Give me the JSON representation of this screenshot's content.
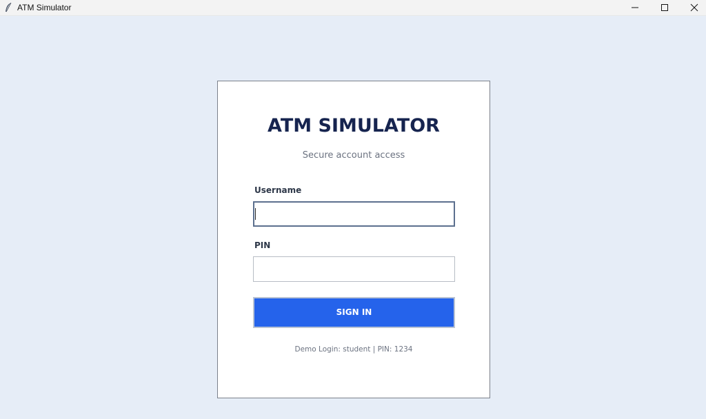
{
  "window": {
    "title": "ATM Simulator",
    "icon": "feather-icon",
    "controls": {
      "minimize": "minimize-icon",
      "maximize": "maximize-icon",
      "close": "close-icon"
    }
  },
  "login": {
    "title": "ATM SIMULATOR",
    "subtitle": "Secure account access",
    "username_label": "Username",
    "username_value": "",
    "pin_label": "PIN",
    "pin_value": "",
    "signin_label": "SIGN IN",
    "demo_text": "Demo Login: student  |  PIN: 1234"
  },
  "colors": {
    "background": "#e6edf7",
    "card": "#ffffff",
    "title": "#16244f",
    "button": "#2563eb",
    "button_text": "#ffffff"
  }
}
